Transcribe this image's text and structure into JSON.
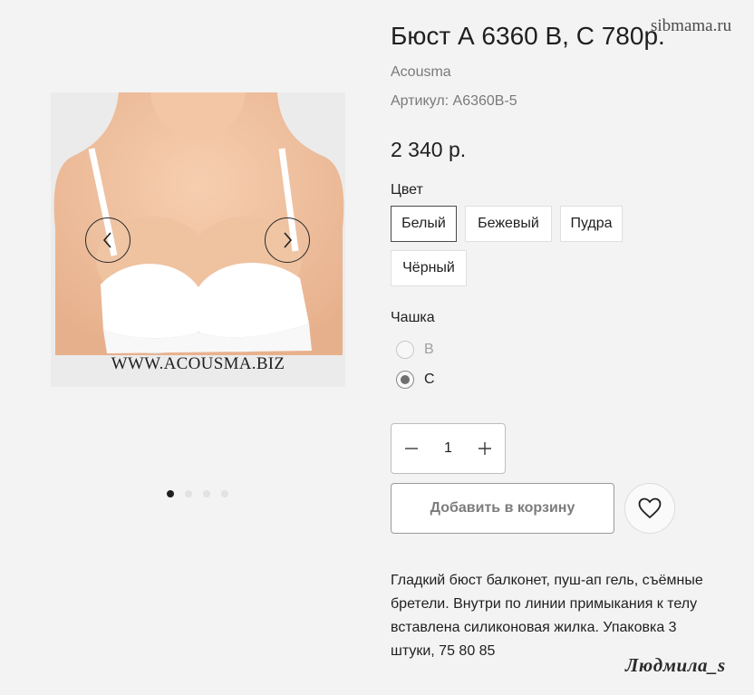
{
  "watermarks": {
    "top": "sibmama.ru",
    "bottom": "Людмила_s"
  },
  "gallery": {
    "image_caption": "WWW.ACOUSMA.BIZ",
    "prev_icon": "chevron-left-icon",
    "next_icon": "chevron-right-icon",
    "dots_total": 4,
    "dots_active_index": 0
  },
  "product": {
    "title": "Бюст А 6360 В, С 780р.",
    "brand": "Acousma",
    "sku": "Артикул: А6360В-5",
    "price": "2 340 р.",
    "color_label": "Цвет",
    "colors": [
      "Белый",
      "Бежевый",
      "Пудра",
      "Чёрный"
    ],
    "selected_color": "Белый",
    "cup_label": "Чашка",
    "cups": [
      {
        "label": "B",
        "disabled": true,
        "checked": false
      },
      {
        "label": "C",
        "disabled": false,
        "checked": true
      }
    ],
    "quantity": "1",
    "add_to_cart": "Добавить в корзину",
    "wishlist_icon": "heart-icon",
    "description": "Гладкий бюст балконет, пуш-ап гель, съёмные бретели. Внутри по линии примыкания к телу вставлена силиконовая жилка. Упаковка 3 штуки, 75 80 85"
  },
  "colors": {
    "text": "#1f1f1f",
    "muted": "#7a7a7a",
    "background": "#f3f3f3",
    "border_selected": "#4a4a4a"
  }
}
